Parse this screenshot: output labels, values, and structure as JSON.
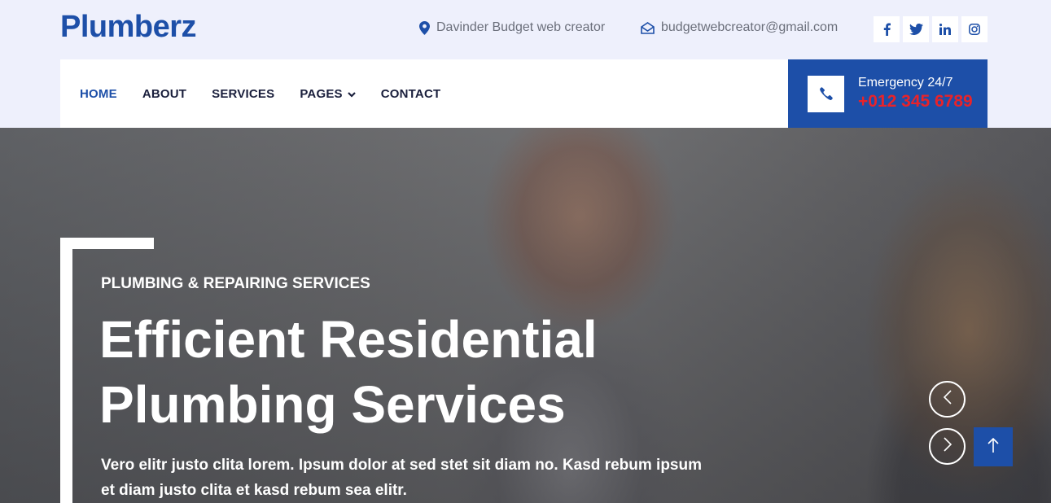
{
  "brand": {
    "name": "Plumberz"
  },
  "topbar": {
    "location_text": "Davinder Budget web creator",
    "email_text": "budgetwebcreator@gmail.com",
    "socials": [
      {
        "icon": "facebook-icon",
        "glyph": "f"
      },
      {
        "icon": "twitter-icon",
        "glyph": "t"
      },
      {
        "icon": "linkedin-icon",
        "glyph": "in"
      },
      {
        "icon": "instagram-icon",
        "glyph": "ig"
      }
    ]
  },
  "nav": {
    "items": [
      {
        "label": "HOME",
        "active": true
      },
      {
        "label": "ABOUT",
        "active": false
      },
      {
        "label": "SERVICES",
        "active": false
      },
      {
        "label": "PAGES",
        "active": false,
        "dropdown": true
      },
      {
        "label": "CONTACT",
        "active": false
      }
    ]
  },
  "emergency": {
    "label": "Emergency 24/7",
    "number": "+012 345 6789"
  },
  "hero": {
    "subtitle": "PLUMBING & REPAIRING SERVICES",
    "title_line1": "Efficient Residential",
    "title_line2": "Plumbing Services",
    "description": "Vero elitr justo clita lorem. Ipsum dolor at sed stet sit diam no. Kasd rebum ipsum et diam justo clita et kasd rebum sea elitr."
  },
  "colors": {
    "brand": "#1d4fa8",
    "topbar_bg": "#eef0fc",
    "emergency_number": "#e8232a",
    "nav_text": "#1a1f3c"
  }
}
